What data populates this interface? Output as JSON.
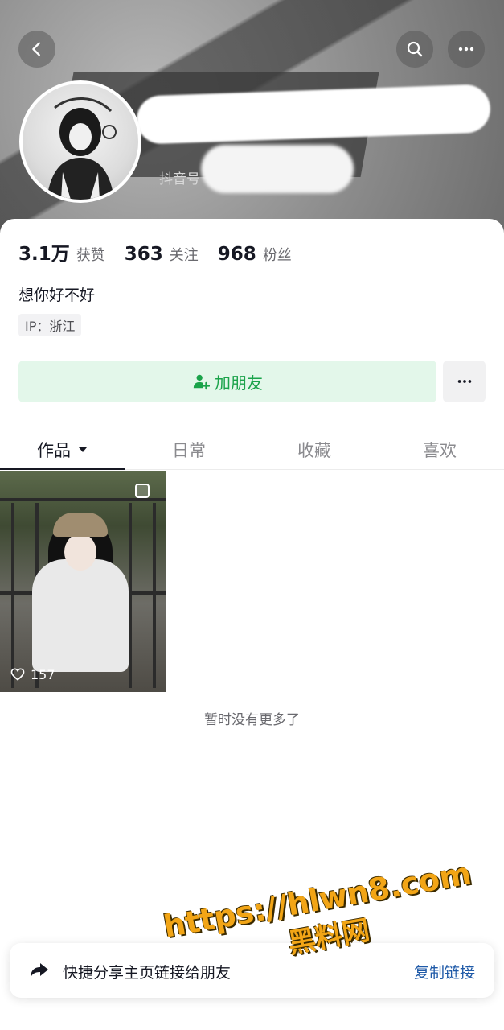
{
  "header": {
    "douyin_id_label": "抖音号",
    "back_icon": "chevron-left-icon",
    "search_icon": "search-icon",
    "more_icon": "more-horizontal-icon"
  },
  "stats": [
    {
      "value": "3.1万",
      "label": "获赞"
    },
    {
      "value": "363",
      "label": "关注"
    },
    {
      "value": "968",
      "label": "粉丝"
    }
  ],
  "profile": {
    "bio": "想你好不好",
    "ip": "IP：浙江"
  },
  "actions": {
    "add_friend_label": "加朋友",
    "add_friend_color": "#1aa34a",
    "add_friend_bg": "#e3f7ea"
  },
  "tabs": [
    {
      "label": "作品",
      "active": true,
      "has_dropdown": true
    },
    {
      "label": "日常",
      "active": false
    },
    {
      "label": "收藏",
      "active": false
    },
    {
      "label": "喜欢",
      "active": false
    }
  ],
  "videos": [
    {
      "likes": "157"
    }
  ],
  "no_more_text": "暂时没有更多了",
  "share_bar": {
    "text": "快捷分享主页链接给朋友",
    "copy_label": "复制链接",
    "copy_color": "#1f5aa8"
  },
  "watermark": {
    "url": "https://hlwn8.com",
    "name": "黑料网"
  }
}
